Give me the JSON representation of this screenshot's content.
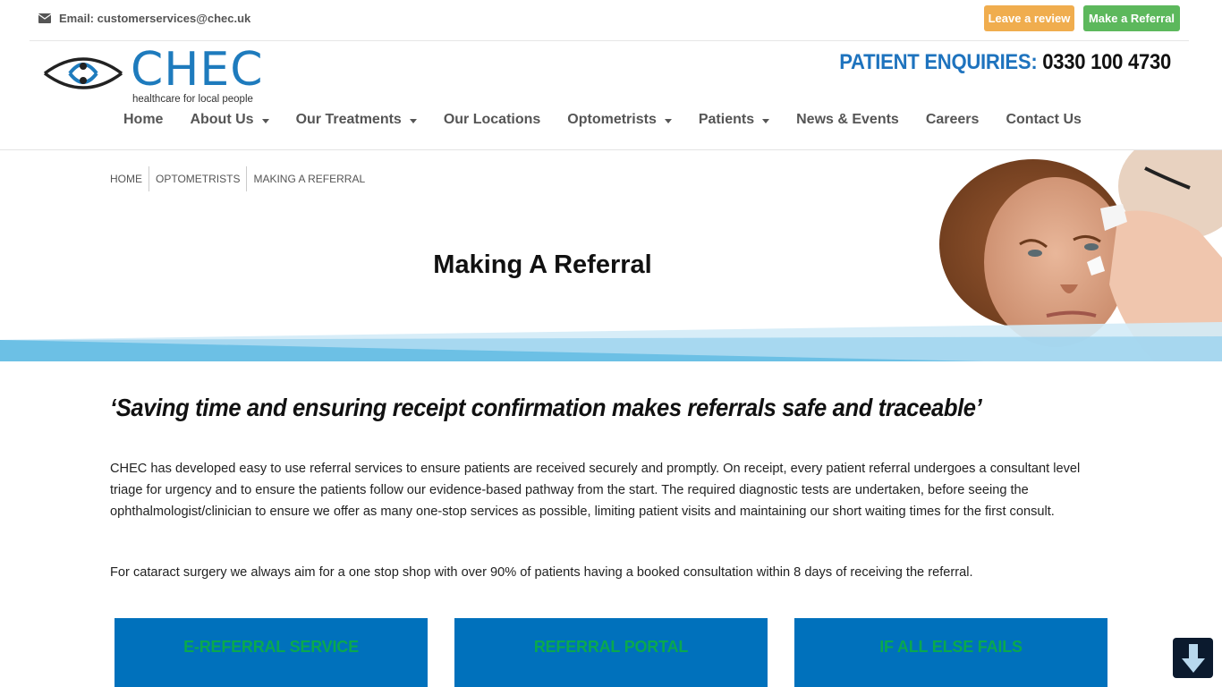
{
  "topbar": {
    "email_icon": "envelope-icon",
    "email_label": "Email: customerservices@chec.uk",
    "review_button": "Leave a review",
    "referral_button": "Make a Referral",
    "colors": {
      "review": "#f0ad4e",
      "referral": "#5cb85c"
    }
  },
  "header": {
    "logo_icon": "eye-logo-icon",
    "brand": "CHEC",
    "tagline": "healthcare for local people",
    "enquiries_label": "PATIENT ENQUIRIES:",
    "enquiries_number": "0330 100 4730",
    "brand_color": "#1e7bbd"
  },
  "nav": {
    "items": [
      {
        "label": "Home",
        "dropdown": false
      },
      {
        "label": "About Us",
        "dropdown": true
      },
      {
        "label": "Our Treatments",
        "dropdown": true
      },
      {
        "label": "Our Locations",
        "dropdown": false
      },
      {
        "label": "Optometrists",
        "dropdown": true
      },
      {
        "label": "Patients",
        "dropdown": true
      },
      {
        "label": "News & Events",
        "dropdown": false
      },
      {
        "label": "Careers",
        "dropdown": false
      },
      {
        "label": "Contact Us",
        "dropdown": false
      }
    ]
  },
  "breadcrumb": [
    "HOME",
    "OPTOMETRISTS",
    "MAKING A REFERRAL"
  ],
  "page": {
    "title": "Making A Referral",
    "quote": "‘Saving time and ensuring receipt confirmation makes referrals safe and traceable’",
    "paragraphs": [
      "CHEC has developed easy to use referral services to ensure patients are received securely and promptly. On receipt, every patient referral undergoes a consultant level triage for urgency and to ensure the patients follow our evidence-based pathway from the start. The required diagnostic tests are undertaken, before seeing the ophthalmologist/clinician to ensure we offer as many one-stop services as possible, limiting patient visits and maintaining our short waiting times for the first consult.",
      "For cataract surgery we always aim for a one stop shop with over 90% of patients having a booked consultation within 8 days of receiving the referral."
    ],
    "cards": [
      "E-REFERRAL SERVICE",
      "REFERRAL PORTAL",
      "IF ALL ELSE FAILS"
    ],
    "card_color": "#0071bc",
    "card_text_color": "#0aa84f"
  },
  "scroll_button": {
    "icon": "arrow-down-icon"
  }
}
